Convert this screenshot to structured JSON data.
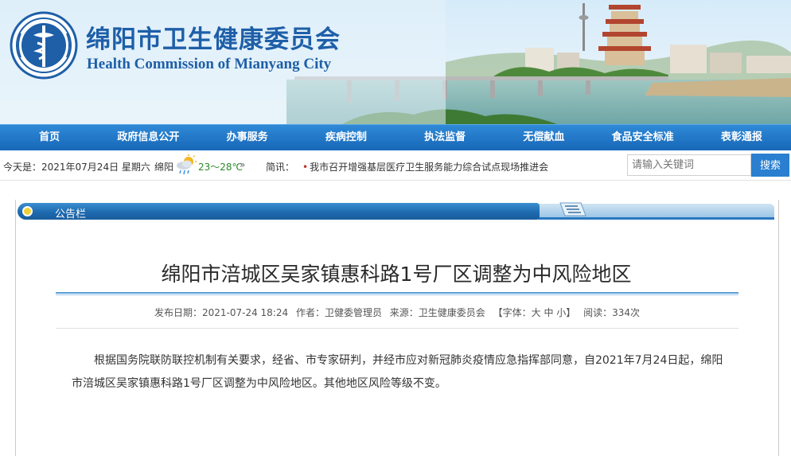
{
  "site": {
    "title_cn": "绵阳市卫生健康委员会",
    "title_en": "Health Commission of Mianyang City"
  },
  "nav": {
    "items": [
      "首页",
      "政府信息公开",
      "办事服务",
      "疾病控制",
      "执法监督",
      "无偿献血",
      "食品安全标准",
      "表彰通报"
    ]
  },
  "infobar": {
    "today": "今天是：2021年07月24日 星期六",
    "weather_city": "绵阳",
    "weather_temp": "23～28℃",
    "weather_more": "»",
    "news_label": "简讯：",
    "news_dot": "•",
    "news_item": "我市召开增强基层医疗卫生服务能力综合试点现场推进会",
    "search_placeholder": "请输入关键词",
    "search_button": "搜索"
  },
  "panel": {
    "title": "公告栏"
  },
  "article": {
    "title": "绵阳市涪城区吴家镇惠科路1号厂区调整为中风险地区",
    "meta": {
      "date": "发布日期：2021-07-24 18:24",
      "author": "作者：卫健委管理员",
      "source": "来源：卫生健康委员会",
      "font": "【字体：大 中 小】",
      "views": "阅读：334次"
    },
    "body": "根据国务院联防联控机制有关要求，经省、市专家研判，并经市应对新冠肺炎疫情应急指挥部同意，自2021年7月24日起，绵阳市涪城区吴家镇惠科路1号厂区调整为中风险地区。其他地区风险等级不变。"
  },
  "colors": {
    "brand_blue": "#1e5fa8",
    "nav_blue": "#1767b8",
    "accent_gold": "#f3d038"
  },
  "icons": {
    "emblem": "health-emblem-icon",
    "weather": "cloud-rain-sun-icon",
    "panel_tab": "list-lines-icon"
  }
}
